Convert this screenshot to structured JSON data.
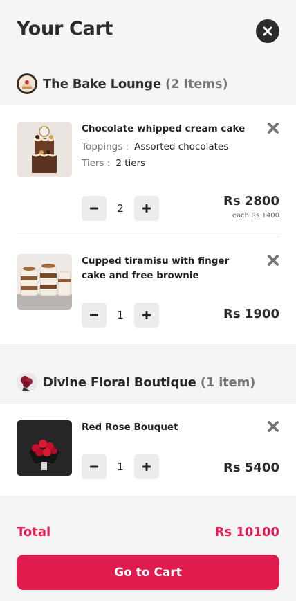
{
  "header": {
    "title": "Your Cart",
    "close_icon": "close-icon"
  },
  "stores": [
    {
      "name": "The Bake Lounge",
      "count": "(2 Items)",
      "items": [
        {
          "name": "Chocolate whipped cream cake",
          "options": [
            {
              "key": "Toppings :",
              "value": "Assorted chocolates"
            },
            {
              "key": "Tiers :",
              "value": "2 tiers"
            }
          ],
          "quantity": "2",
          "price": "Rs 2800",
          "each": "each Rs 1400"
        },
        {
          "name": "Cupped tiramisu with finger cake and free brownie",
          "quantity": "1",
          "price": "Rs 1900"
        }
      ]
    },
    {
      "name": "Divine Floral Boutique",
      "count": "(1 item)",
      "items": [
        {
          "name": "Red Rose Bouquet",
          "quantity": "1",
          "price": "Rs 5400"
        }
      ]
    }
  ],
  "footer": {
    "total_label": "Total",
    "total_value": "Rs 10100",
    "button_label": "Go to Cart"
  },
  "colors": {
    "accent": "#e01c4f",
    "dark": "#2b2b2b",
    "muted": "#777777",
    "qty_button_bg": "#ececec"
  },
  "icons": [
    "close-icon",
    "remove-icon",
    "minus-icon",
    "plus-icon"
  ]
}
